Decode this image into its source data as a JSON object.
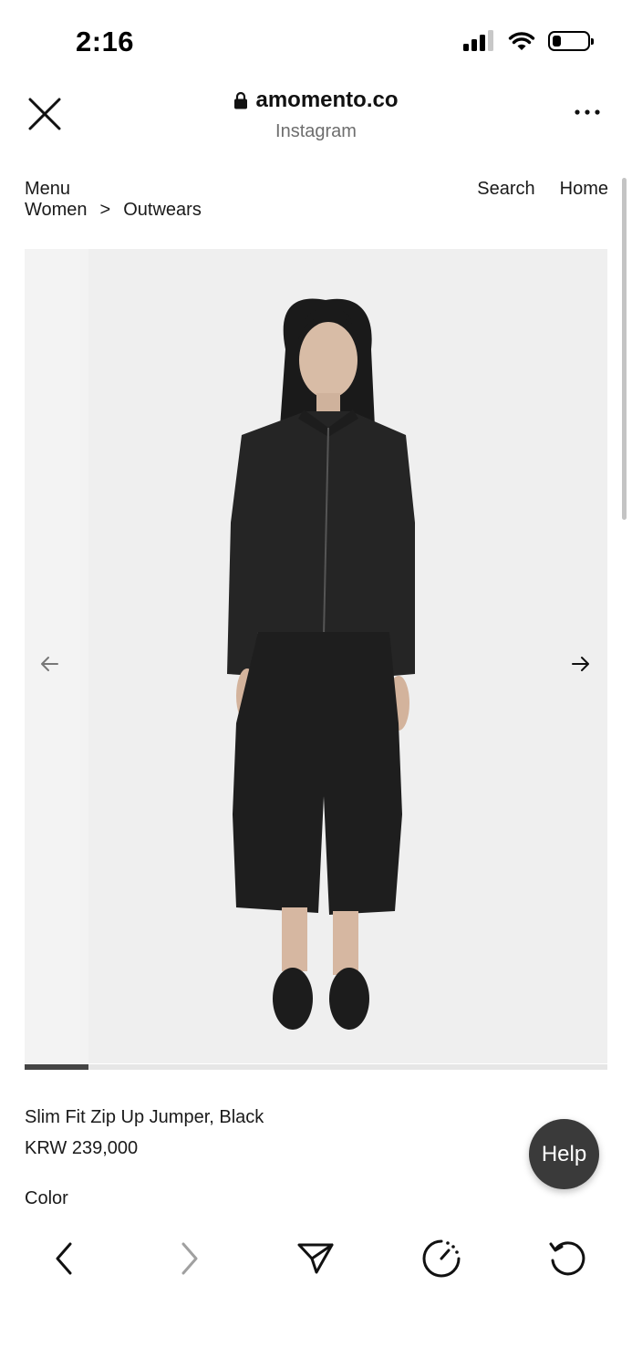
{
  "status_bar": {
    "time": "2:16",
    "icons": [
      "signal-icon",
      "wifi-icon",
      "battery-icon"
    ],
    "battery_level": 0.25
  },
  "browser": {
    "url": "amomento.co",
    "source": "Instagram",
    "icons": [
      "close-icon",
      "lock-icon",
      "more-icon"
    ]
  },
  "site_nav": {
    "menu": "Menu",
    "breadcrumb": [
      "Women",
      ">",
      "Outwears"
    ],
    "search": "Search",
    "home": "Home"
  },
  "gallery": {
    "background": "#efefef",
    "progress": 0.11,
    "icons": [
      "arrow-left-icon",
      "arrow-right-icon"
    ]
  },
  "product": {
    "name": "Slim Fit Zip Up Jumper, Black",
    "price": "KRW 239,000",
    "color_label": "Color"
  },
  "help": {
    "label": "Help"
  },
  "toolbar": {
    "icons": [
      "back-icon",
      "forward-icon",
      "share-icon",
      "speed-icon",
      "reload-icon"
    ]
  }
}
